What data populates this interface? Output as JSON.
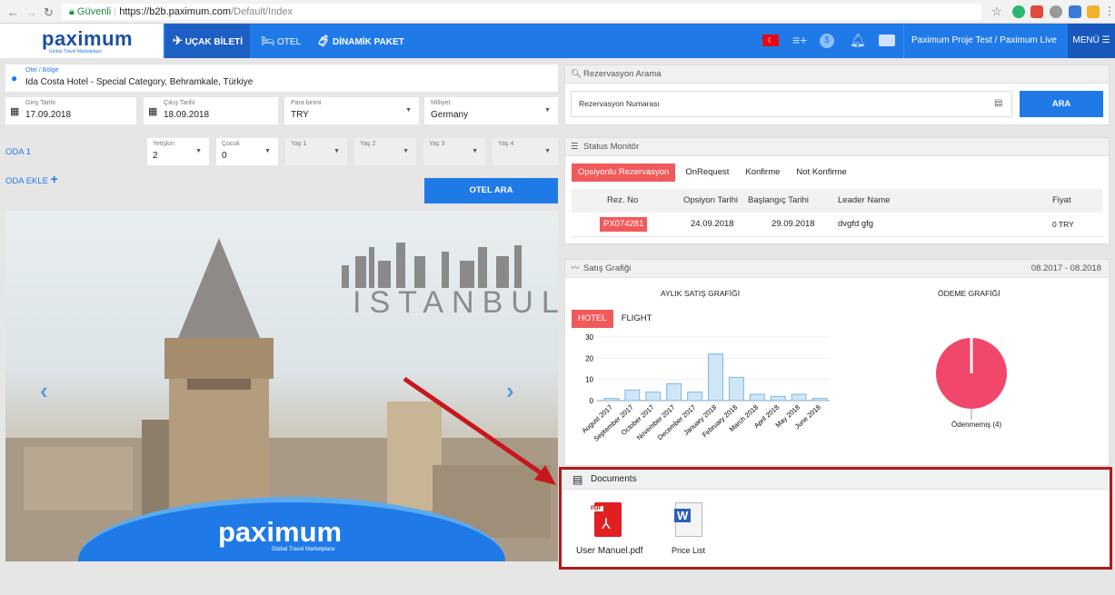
{
  "browser": {
    "url_secure": "Güvenli",
    "url_host": "https://b2b.paximum.com",
    "url_path": "/Default/Index"
  },
  "header": {
    "logo": "paximum",
    "logo_tagline": "Global Travel Marketplace",
    "nav": {
      "flight": "UÇAK BİLETİ",
      "hotel": "OTEL",
      "dynamic": "DİNAMİK PAKET"
    },
    "project": "Paximum Proje Test / Paximum Live",
    "menu": "MENÜ"
  },
  "search": {
    "location_label": "Otel / Bölge",
    "location_value": "Ida Costa Hotel - Special Category, Behramkale, Türkiye",
    "checkin_label": "Giriş Tarihi",
    "checkin_value": "17.09.2018",
    "checkout_label": "Çıkış Tarihi",
    "checkout_value": "18.09.2018",
    "currency_label": "Para birimi",
    "currency_value": "TRY",
    "nationality_label": "Milliyet",
    "nationality_value": "Germany",
    "room_label": "ODA 1",
    "adult_label": "Yetişkin",
    "adult_value": "2",
    "child_label": "Çocuk",
    "child_value": "0",
    "age1": "Yaş 1",
    "age2": "Yaş 2",
    "age3": "Yaş 3",
    "age4": "Yaş 4",
    "add_room": "ODA EKLE",
    "submit": "OTEL ARA"
  },
  "banner": {
    "city": "ISTANBUL",
    "brand": "paximum",
    "brand_tagline": "Global Travel Marketplace"
  },
  "reservation_search": {
    "title": "Rezervasyon Arama",
    "placeholder": "Rezervasyon Numarası",
    "button": "ARA"
  },
  "status_monitor": {
    "title": "Status Monitör",
    "tabs": [
      "Opsiyonlu Rezervasyon",
      "OnRequest",
      "Konfirme",
      "Not Konfirme"
    ],
    "columns": [
      "Rez. No",
      "Opsiyon Tarihi",
      "Başlangıç Tarihi",
      "Leader Name",
      "Fiyat"
    ],
    "rows": [
      [
        "PX074281",
        "24.09.2018",
        "29.09.2018",
        "dvgfd gfg",
        "0 TRY"
      ]
    ]
  },
  "sales": {
    "title": "Satış Grafiği",
    "range": "08.2017 - 08.2018",
    "monthly_title": "AYLIK SATIŞ GRAFİĞİ",
    "payment_title": "ÖDEME GRAFİĞİ",
    "tab_hotel": "HOTEL",
    "tab_flight": "FLIGHT",
    "pie_label": "Ödenmemiş (4)"
  },
  "chart_data": [
    {
      "type": "bar",
      "title": "AYLIK SATIŞ GRAFİĞİ",
      "categories": [
        "August 2017",
        "September 2017",
        "October 2017",
        "November 2017",
        "December 2017",
        "January 2018",
        "February 2018",
        "March 2018",
        "April 2018",
        "May 2018",
        "June 2018"
      ],
      "values": [
        1,
        5,
        4,
        8,
        4,
        22,
        11,
        3,
        2,
        3,
        1
      ],
      "ylim": [
        0,
        30
      ],
      "yticks": [
        0,
        10,
        20,
        30
      ],
      "color": "#cfe6f7",
      "stroke": "#7fb7e0"
    },
    {
      "type": "pie",
      "title": "ÖDEME GRAFİĞİ",
      "labels": [
        "Ödenmemiş (4)"
      ],
      "values": [
        4
      ],
      "color": "#f0476a"
    }
  ],
  "documents": {
    "title": "Documents",
    "items": [
      {
        "label": "User Manuel.pdf",
        "icon": "pdf-icon"
      },
      {
        "label": "Price List",
        "icon": "word-icon"
      }
    ]
  },
  "colors": {
    "accent": "#1f7ae8",
    "danger": "#f05a5a",
    "highlight_border": "#b01a1a"
  }
}
